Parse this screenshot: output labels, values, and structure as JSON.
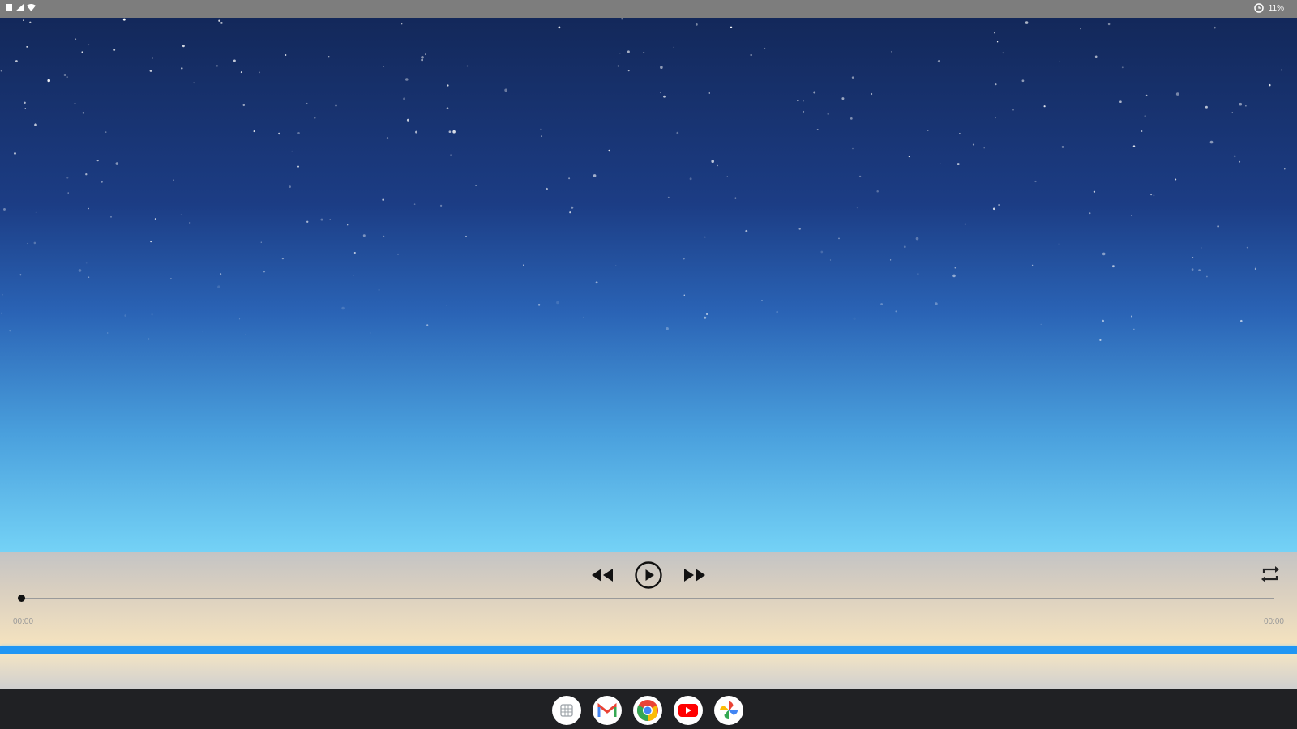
{
  "status_bar": {
    "left_icons": [
      "sim-icon",
      "signal-icon",
      "wifi-icon"
    ],
    "right_icons": [
      "clock-icon"
    ],
    "right_text": "11%"
  },
  "wallpaper": {
    "colors": [
      "#13285a",
      "#1c3d85",
      "#2a63b5",
      "#4aa0dd",
      "#74d2f6"
    ]
  },
  "player": {
    "controls": [
      "rewind-icon",
      "play-icon",
      "fast-forward-icon"
    ],
    "repeat_icon": "repeat-icon",
    "progress": 0,
    "time_elapsed": "00:00",
    "time_total": "00:00"
  },
  "colors": {
    "accent_line": "#2196f3",
    "shelf": "#202124"
  },
  "shelf": {
    "apps": [
      {
        "name": "launcher-icon"
      },
      {
        "name": "gmail-icon"
      },
      {
        "name": "chrome-icon"
      },
      {
        "name": "youtube-icon"
      },
      {
        "name": "photos-icon"
      }
    ]
  }
}
